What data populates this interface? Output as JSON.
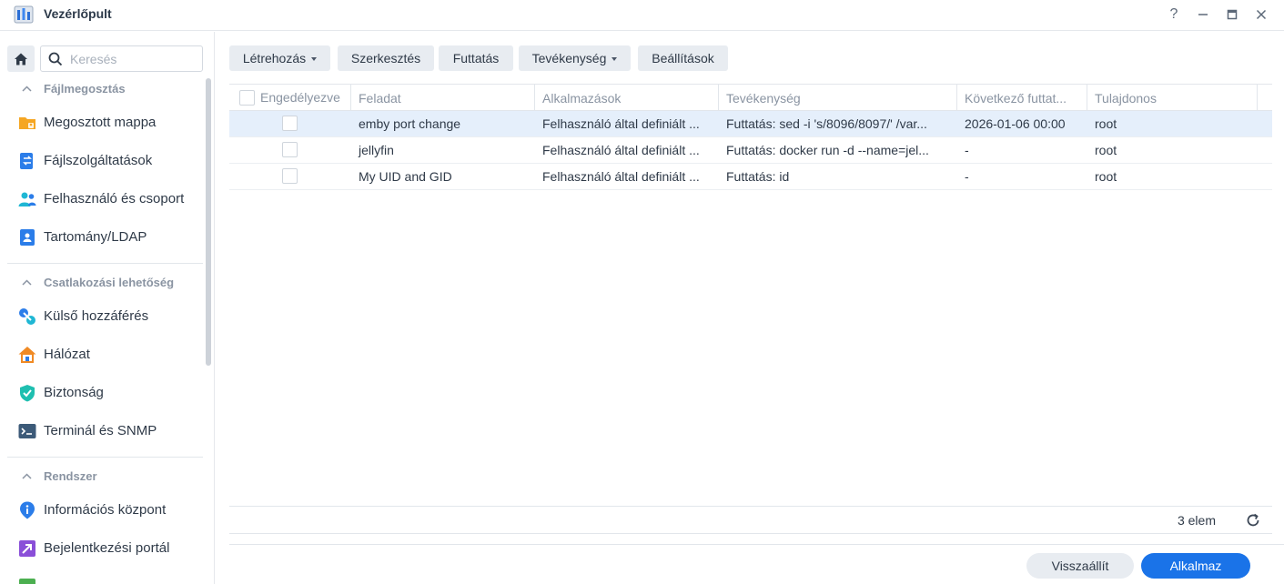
{
  "window": {
    "title": "Vezérlőpult",
    "controls": {
      "help": "?",
      "minimize": "—",
      "maximize": "□",
      "close": "✕"
    }
  },
  "sidebar": {
    "search_placeholder": "Keresés",
    "sections": [
      {
        "title": "Fájlmegosztás",
        "items": [
          "Megosztott mappa",
          "Fájlszolgáltatások",
          "Felhasználó és csoport",
          "Tartomány/LDAP"
        ]
      },
      {
        "title": "Csatlakozási lehetőség",
        "items": [
          "Külső hozzáférés",
          "Hálózat",
          "Biztonság",
          "Terminál és SNMP"
        ]
      },
      {
        "title": "Rendszer",
        "items": [
          "Információs központ",
          "Bejelentkezési portál"
        ]
      }
    ]
  },
  "toolbar": {
    "create": "Létrehozás",
    "edit": "Szerkesztés",
    "run": "Futtatás",
    "action": "Tevékenység",
    "settings": "Beállítások"
  },
  "table": {
    "columns": [
      "Engedélyezve",
      "Feladat",
      "Alkalmazások",
      "Tevékenység",
      "Következő futtat...",
      "Tulajdonos"
    ],
    "rows": [
      {
        "task": "emby port change",
        "app": "Felhasználó által definiált ...",
        "action": "Futtatás: sed -i 's/8096/8097/' /var...",
        "next_run": "2026-01-06 00:00",
        "owner": "root",
        "enabled": false,
        "selected": true
      },
      {
        "task": "jellyfin",
        "app": "Felhasználó által definiált ...",
        "action": "Futtatás: docker run -d --name=jel...",
        "next_run": "-",
        "owner": "root",
        "enabled": false,
        "selected": false
      },
      {
        "task": "My UID and GID",
        "app": "Felhasználó által definiált ...",
        "action": "Futtatás: id",
        "next_run": "-",
        "owner": "root",
        "enabled": false,
        "selected": false
      }
    ],
    "count": "3 elem"
  },
  "footer": {
    "reset": "Visszaállít",
    "apply": "Alkalmaz"
  },
  "colors": {
    "accent": "#1a73e8",
    "selected_row": "#e5effb",
    "button_bg": "#e8ecf1"
  }
}
